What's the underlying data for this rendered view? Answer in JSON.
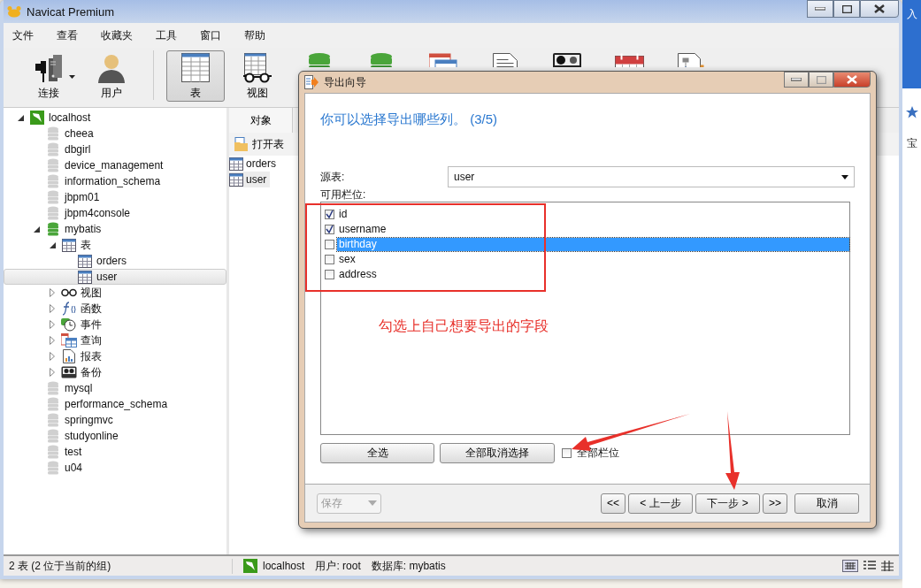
{
  "window": {
    "title": "Navicat Premium"
  },
  "menu": [
    "文件",
    "查看",
    "收藏夹",
    "工具",
    "窗口",
    "帮助"
  ],
  "toolbar": [
    {
      "kind": "connection",
      "label": "连接",
      "selected": false
    },
    {
      "kind": "user",
      "label": "用户",
      "selected": false
    },
    {
      "kind": "table",
      "label": "表",
      "selected": true
    },
    {
      "kind": "view",
      "label": "视图",
      "selected": false
    },
    {
      "kind": "function",
      "selected": false
    },
    {
      "kind": "event",
      "selected": false
    },
    {
      "kind": "query",
      "selected": false
    },
    {
      "kind": "report",
      "selected": false
    },
    {
      "kind": "backup",
      "selected": false
    },
    {
      "kind": "schedule",
      "selected": false
    },
    {
      "kind": "model",
      "selected": false
    }
  ],
  "tree": [
    {
      "label": "localhost",
      "kind": "server",
      "expanded": true,
      "selected": false,
      "children": [
        {
          "label": "cheea",
          "kind": "db",
          "selected": false
        },
        {
          "label": "dbgirl",
          "kind": "db",
          "selected": false
        },
        {
          "label": "device_management",
          "kind": "db",
          "selected": false
        },
        {
          "label": "information_schema",
          "kind": "db",
          "selected": false
        },
        {
          "label": "jbpm01",
          "kind": "db",
          "selected": false
        },
        {
          "label": "jbpm4console",
          "kind": "db",
          "selected": false
        },
        {
          "label": "mybatis",
          "kind": "db_open",
          "expanded": true,
          "selected": false,
          "children": [
            {
              "label": "表",
              "kind": "table",
              "expanded": true,
              "selected": false,
              "children": [
                {
                  "label": "orders",
                  "kind": "table",
                  "selected": false
                },
                {
                  "label": "user",
                  "kind": "table",
                  "selected": true
                }
              ]
            },
            {
              "label": "视图",
              "kind": "view",
              "expanded": false,
              "selected": false
            },
            {
              "label": "函数",
              "kind": "function",
              "expanded": false,
              "selected": false
            },
            {
              "label": "事件",
              "kind": "event",
              "expanded": false,
              "selected": false
            },
            {
              "label": "查询",
              "kind": "query",
              "expanded": false,
              "selected": false
            },
            {
              "label": "报表",
              "kind": "report",
              "expanded": false,
              "selected": false
            },
            {
              "label": "备份",
              "kind": "backup",
              "expanded": false,
              "selected": false
            }
          ]
        },
        {
          "label": "mysql",
          "kind": "db",
          "selected": false
        },
        {
          "label": "performance_schema",
          "kind": "db",
          "selected": false
        },
        {
          "label": "springmvc",
          "kind": "db",
          "selected": false
        },
        {
          "label": "studyonline",
          "kind": "db",
          "selected": false
        },
        {
          "label": "test",
          "kind": "db",
          "selected": false
        },
        {
          "label": "u04",
          "kind": "db",
          "selected": false
        }
      ]
    }
  ],
  "objects_panel": {
    "tab": "对象",
    "open_table": "打开表",
    "items": [
      {
        "label": "orders",
        "selected": false
      },
      {
        "label": "user",
        "selected": true
      }
    ]
  },
  "status_bar": {
    "summary": "2 表 (2 位于当前的组)",
    "connection": "localhost",
    "user": "用户: root",
    "database": "数据库: mybatis"
  },
  "dialog": {
    "title": "导出向导",
    "heading": "你可以选择导出哪些列。 (3/5)",
    "source_label": "源表:",
    "source_value": "user",
    "fields_label": "可用栏位:",
    "fields": [
      {
        "name": "id",
        "checked": true,
        "selected": false
      },
      {
        "name": "username",
        "checked": true,
        "selected": false
      },
      {
        "name": "birthday",
        "checked": false,
        "selected": true
      },
      {
        "name": "sex",
        "checked": false,
        "selected": false
      },
      {
        "name": "address",
        "checked": false,
        "selected": false
      }
    ],
    "select_all": "全选",
    "deselect_all": "全部取消选择",
    "all_fields": {
      "label": "全部栏位",
      "checked": false
    },
    "save": {
      "label": "保存",
      "disabled": true
    },
    "nav": [
      "<<",
      "< 上一步",
      "下一步 >",
      ">>"
    ],
    "cancel": "取消"
  },
  "annotation": {
    "note": "勾选上自己想要导出的字段"
  },
  "background_page": [
    "入",
    "宝"
  ]
}
